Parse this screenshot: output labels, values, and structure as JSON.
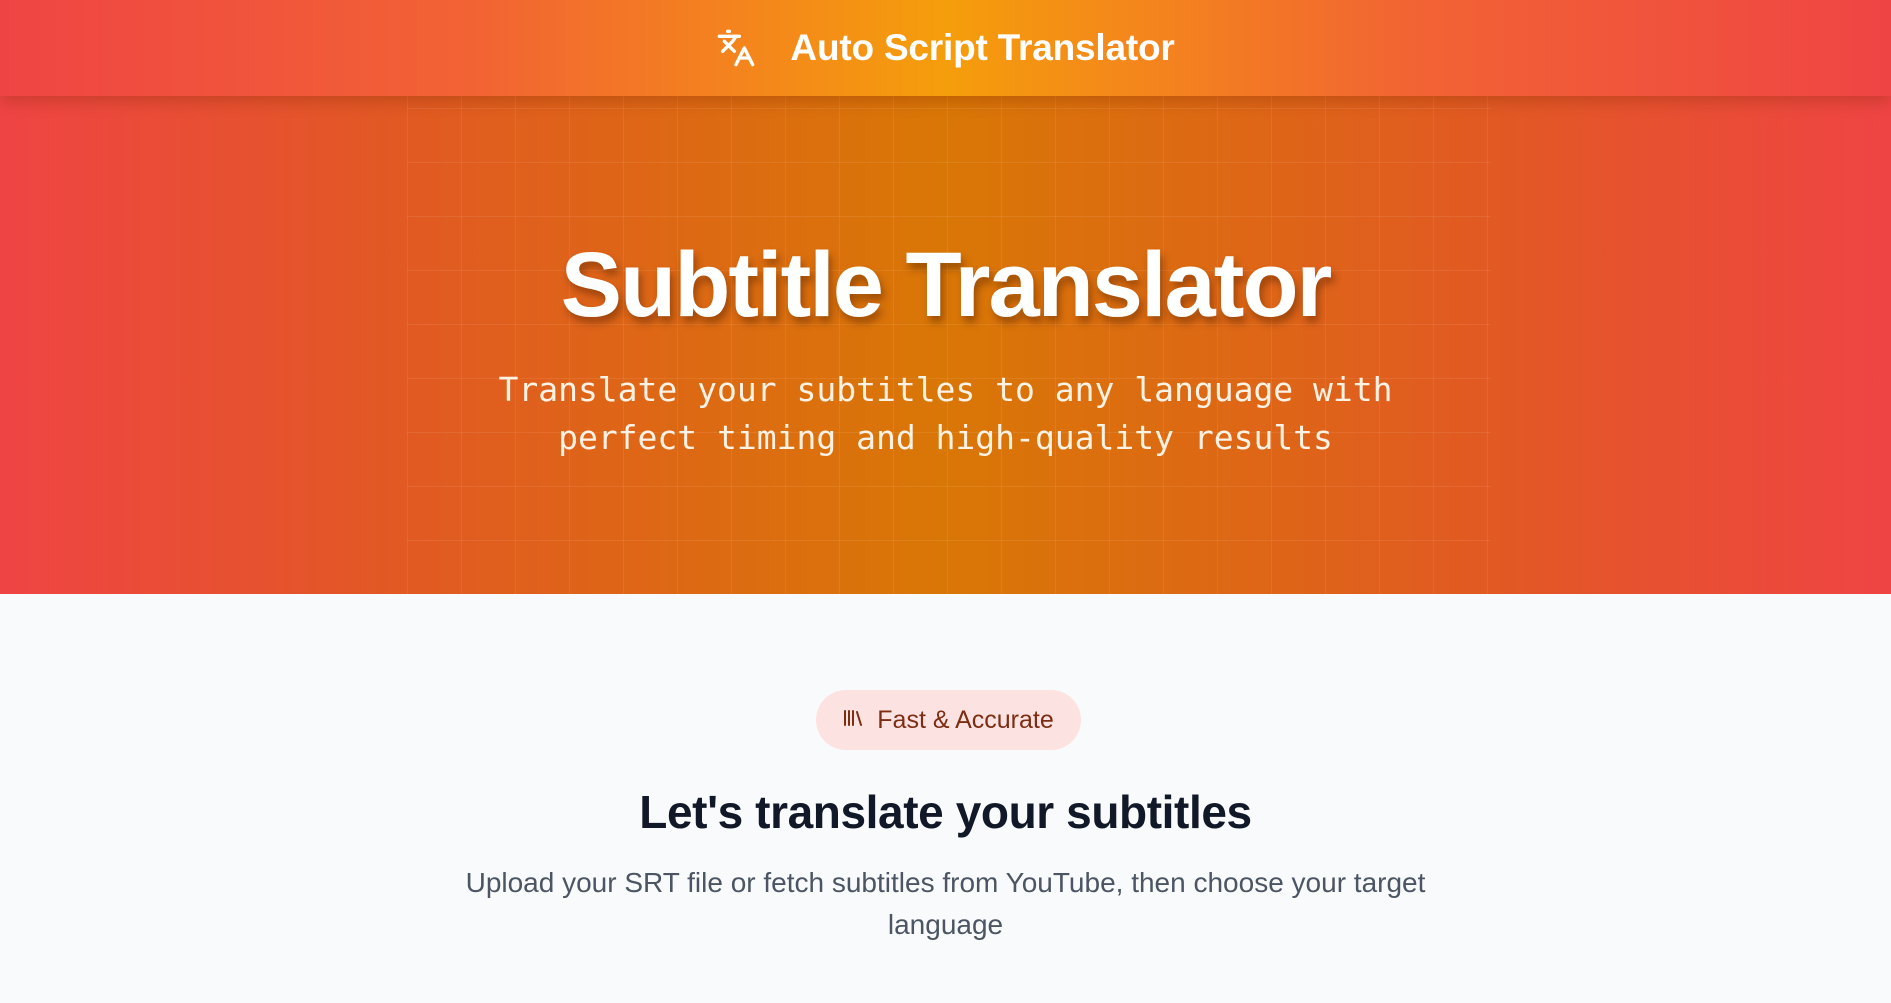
{
  "nav": {
    "brand_icon": "translate-icon",
    "brand_title": "Auto Script Translator"
  },
  "hero": {
    "title": "Subtitle Translator",
    "subtitle": "Translate your subtitles to any language with perfect timing and high-quality results"
  },
  "section": {
    "badge_icon": "library-icon",
    "badge_label": "Fast & Accurate",
    "title": "Let's translate your subtitles",
    "description": "Upload your SRT file or fetch subtitles from YouTube, then choose your target language"
  },
  "colors": {
    "gradient_edge": "#ef4444",
    "gradient_center": "#f59e0b",
    "badge_bg": "#fde2e2",
    "badge_text": "#7c2d12",
    "heading": "#111827",
    "body_text": "#4b5563",
    "page_bg": "#f9fafb"
  }
}
